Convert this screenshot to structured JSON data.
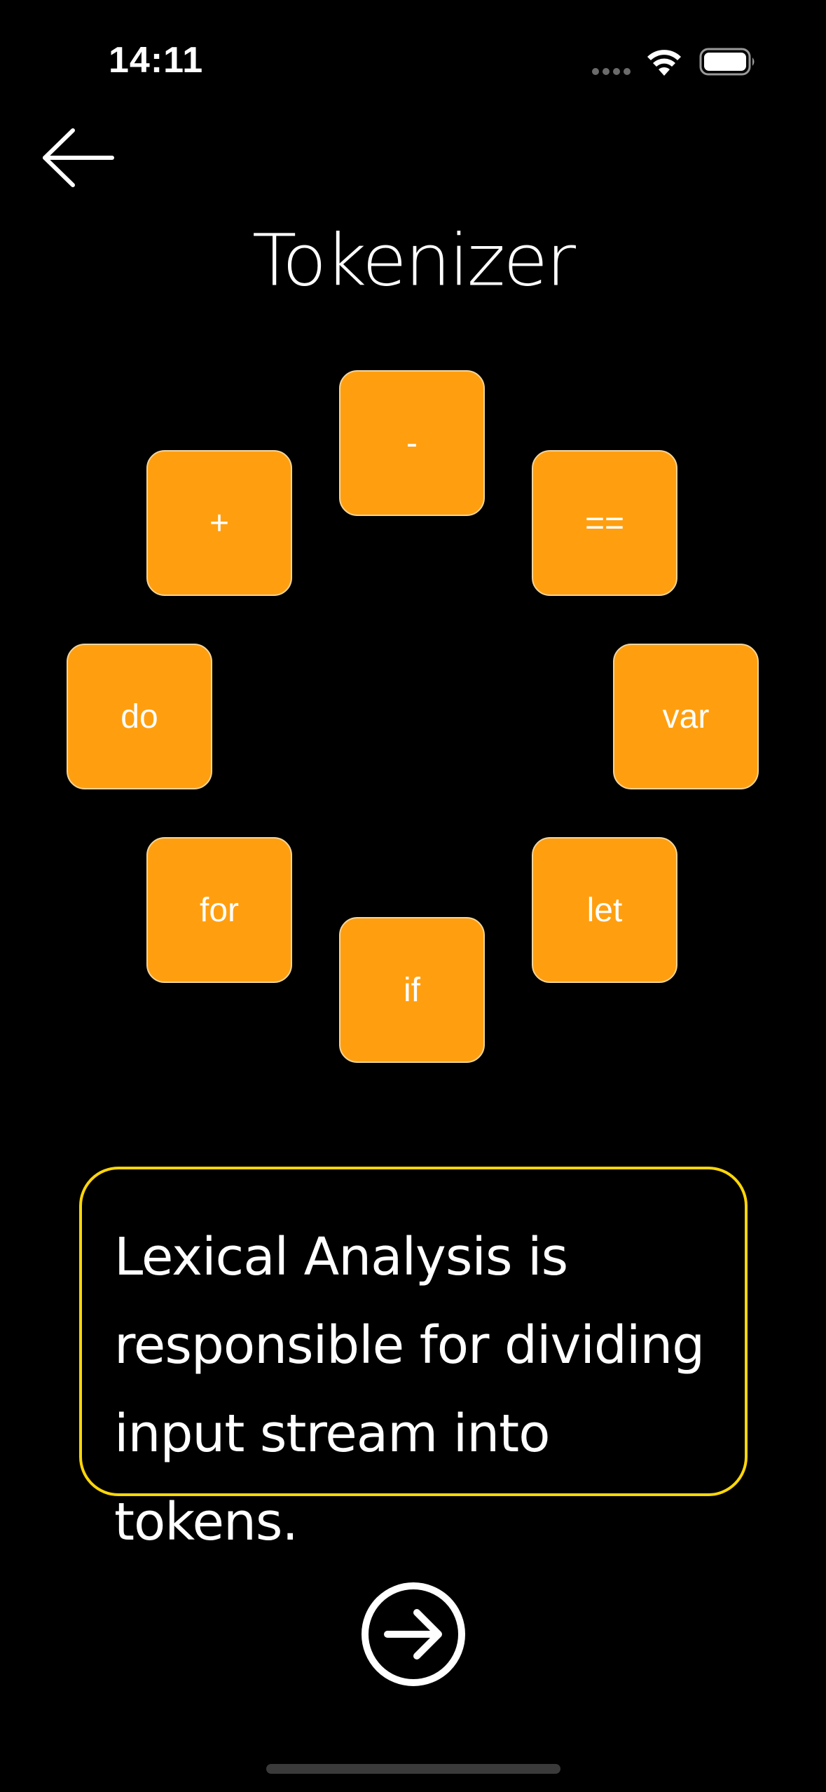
{
  "status_bar": {
    "time": "14:11",
    "icons": [
      "cellular-signal-icon",
      "wifi-icon",
      "battery-icon"
    ]
  },
  "header": {
    "back_icon": "arrow-left-icon",
    "title": "Tokenizer"
  },
  "tokens": [
    {
      "label": "-"
    },
    {
      "label": "+"
    },
    {
      "label": "=="
    },
    {
      "label": "do"
    },
    {
      "label": "var"
    },
    {
      "label": "for"
    },
    {
      "label": "let"
    },
    {
      "label": "if"
    }
  ],
  "info": {
    "lines": [
      "Lexical Analysis is",
      "responsible for dividing",
      "input stream into tokens."
    ]
  },
  "footer": {
    "next_icon": "arrow-right-circle-icon"
  },
  "colors": {
    "background": "#000000",
    "token_fill": "#ff9f0f",
    "card_border": "#ffd60a",
    "text": "#ffffff"
  }
}
